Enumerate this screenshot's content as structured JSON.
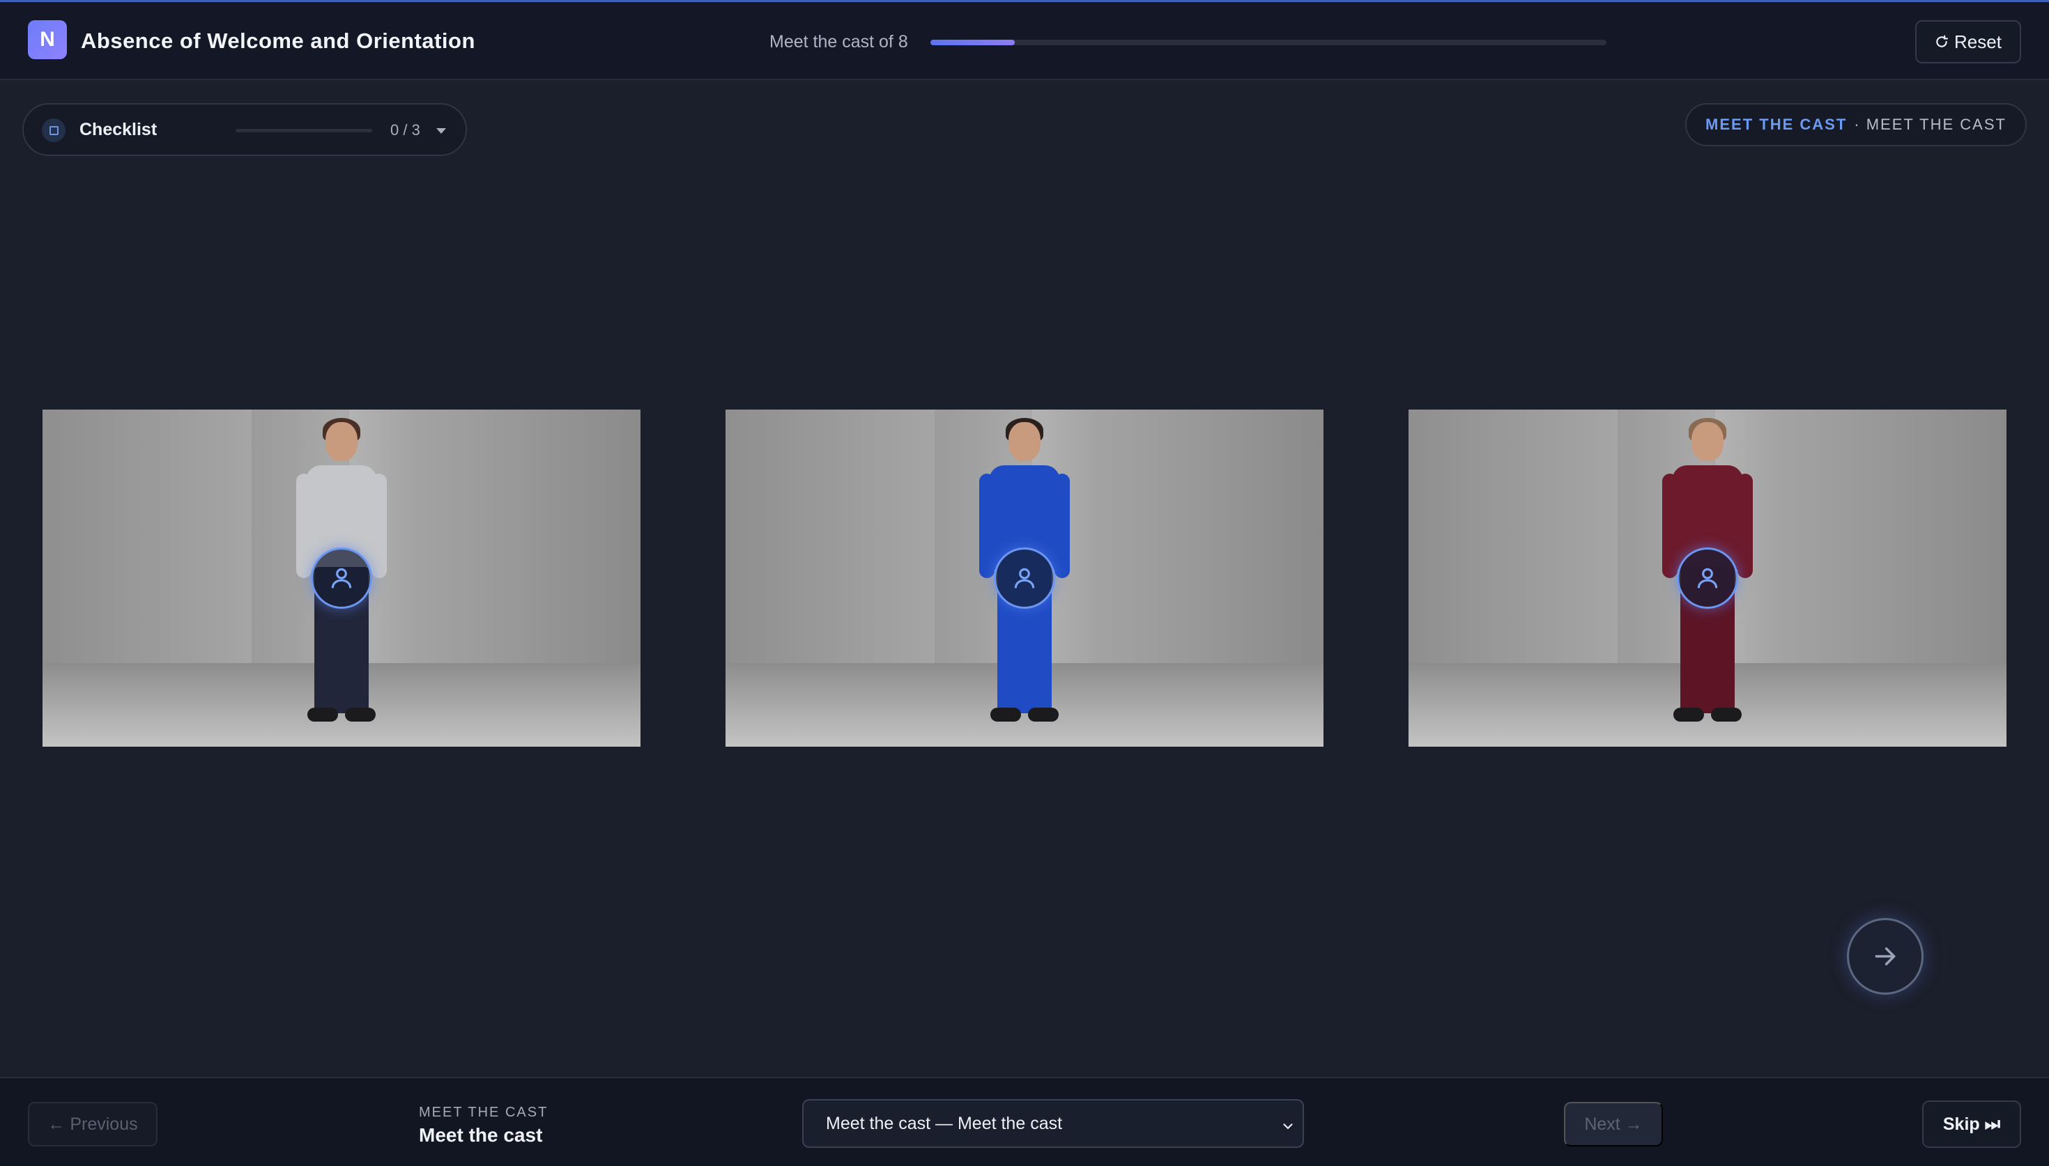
{
  "header": {
    "logo_letter": "N",
    "title": "Absence of Welcome and Orientation",
    "progress_label": "Meet the cast of 8",
    "progress_fraction": 0.125,
    "reset_label": "Reset",
    "reset_icon": "refresh-icon"
  },
  "checklist": {
    "label": "Checklist",
    "count": "0 / 3",
    "completed": 0,
    "total": 3,
    "icon": "checkbox-icon"
  },
  "scene_pill": {
    "kicker": "MEET THE CAST",
    "detail": "· MEET THE CAST"
  },
  "cast": [
    {
      "name": "cast-member-1",
      "uniform_color": "#c4c6c9",
      "trouser_color": "#22263a",
      "hair_color": "#4a2f24"
    },
    {
      "name": "cast-member-2",
      "uniform_color": "#1f4cc4",
      "trouser_color": "#1f4cc4",
      "hair_color": "#2b211c"
    },
    {
      "name": "cast-member-3",
      "uniform_color": "#6d1a2c",
      "trouser_color": "#5d1526",
      "hair_color": "#8a6a50"
    }
  ],
  "footer": {
    "previous_label": "← Previous",
    "scene_kicker": "MEET THE CAST",
    "scene_name": "Meet the cast",
    "scene_select_value": "Meet the cast — Meet the cast",
    "next_label": "Next →",
    "skip_label": "Skip ⏭"
  },
  "colors": {
    "accent": "#6c9bf6",
    "background": "#1b1f2b",
    "header_bg": "#141826"
  }
}
